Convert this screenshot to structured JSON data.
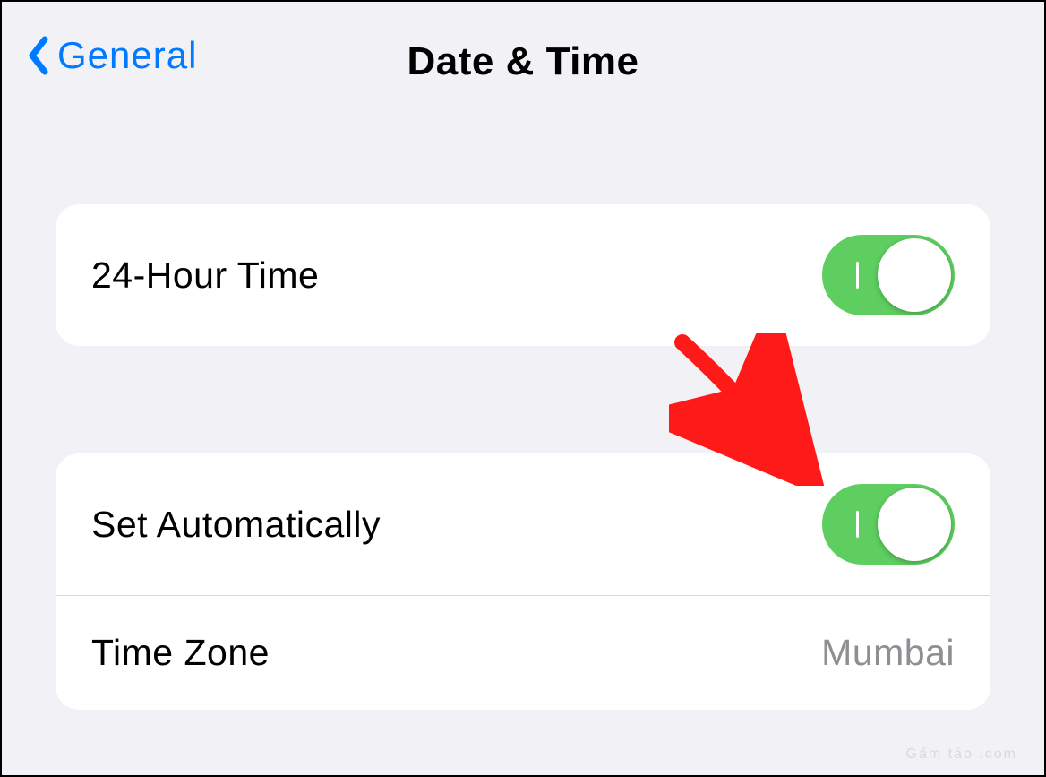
{
  "nav": {
    "back_label": "General",
    "title": "Date & Time"
  },
  "groups": [
    {
      "rows": [
        {
          "label": "24-Hour Time",
          "switch_on": true
        }
      ]
    },
    {
      "rows": [
        {
          "label": "Set Automatically",
          "switch_on": true
        },
        {
          "label": "Time Zone",
          "value": "Mumbai"
        }
      ]
    }
  ],
  "watermark": "Gấm táo .com"
}
